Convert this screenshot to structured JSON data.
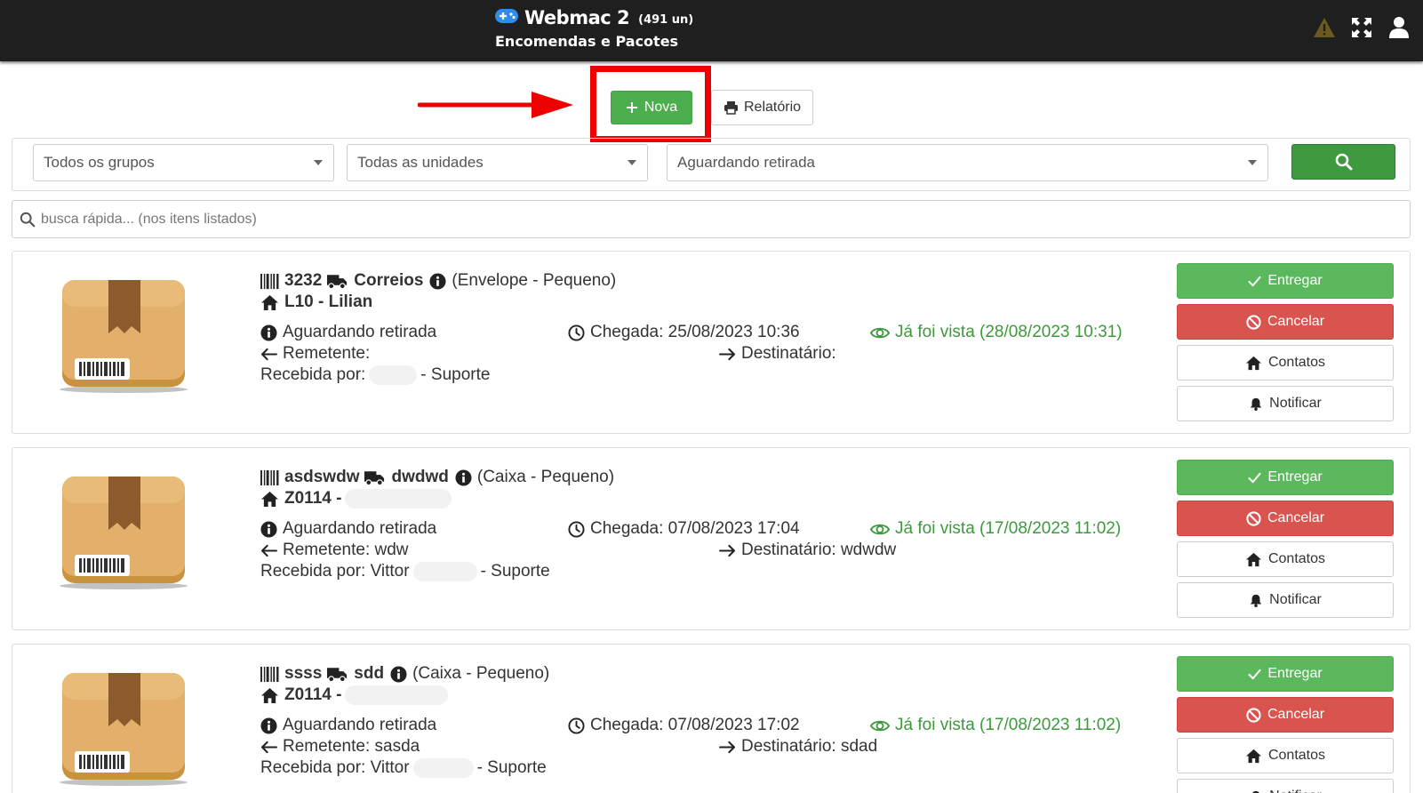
{
  "header": {
    "app_name": "Webmac 2",
    "count": "(491 un)",
    "subtitle": "Encomendas e Pacotes"
  },
  "toolbar": {
    "new_label": "Nova",
    "report_label": "Relatório"
  },
  "filters": {
    "group": "Todos os grupos",
    "unit": "Todas as unidades",
    "status": "Aguardando retirada"
  },
  "quick_search": {
    "placeholder": "busca rápida... (nos itens listados)"
  },
  "colors": {
    "header_bg": "#1f1f1f",
    "green": "#5cb85c",
    "red": "#d9534f",
    "highlight": "#ef0000",
    "seen_text": "#3c9a3c"
  },
  "actions": {
    "deliver": "Entregar",
    "cancel": "Cancelar",
    "contacts": "Contatos",
    "notify": "Notificar"
  },
  "packages": [
    {
      "code": "3232",
      "carrier": "Correios",
      "type": "(Envelope - Pequeno)",
      "unit": "L10 - Lilian",
      "status": "Aguardando retirada",
      "arrival": "Chegada: 25/08/2023 10:36",
      "seen": "Já foi vista (28/08/2023 10:31)",
      "sender": "Remetente:",
      "recipient": "Destinatário:",
      "received_prefix": "Recebida por:",
      "received_suffix": "- Suporte"
    },
    {
      "code": "asdswdw",
      "carrier": "dwdwd",
      "type": "(Caixa - Pequeno)",
      "unit": "Z0114 -",
      "status": "Aguardando retirada",
      "arrival": "Chegada: 07/08/2023 17:04",
      "seen": "Já foi vista (17/08/2023 11:02)",
      "sender": "Remetente: wdw",
      "recipient": "Destinatário: wdwdw",
      "received_prefix": "Recebida por: Vittor",
      "received_suffix": "- Suporte"
    },
    {
      "code": "ssss",
      "carrier": "sdd",
      "type": "(Caixa - Pequeno)",
      "unit": "Z0114 -",
      "status": "Aguardando retirada",
      "arrival": "Chegada: 07/08/2023 17:02",
      "seen": "Já foi vista (17/08/2023 11:02)",
      "sender": "Remetente: sasda",
      "recipient": "Destinatário: sdad",
      "received_prefix": "Recebida por: Vittor",
      "received_suffix": "- Suporte"
    }
  ]
}
